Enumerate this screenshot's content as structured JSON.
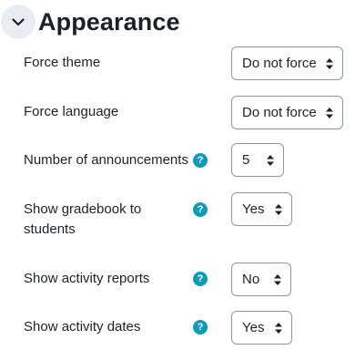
{
  "section": {
    "title": "Appearance",
    "toggle_icon": "chevron-down-icon"
  },
  "fields": [
    {
      "label": "Force theme",
      "value": "Do not force",
      "has_help": false
    },
    {
      "label": "Force language",
      "value": "Do not force",
      "has_help": false
    },
    {
      "label": "Number of announcements",
      "value": "5",
      "has_help": true
    },
    {
      "label_line1": "Show gradebook to",
      "label_line2": "students",
      "value": "Yes",
      "has_help": true
    },
    {
      "label": "Show activity reports",
      "value": "No",
      "has_help": true
    },
    {
      "label": "Show activity dates",
      "value": "Yes",
      "has_help": true
    }
  ],
  "help_icon": {
    "glyph": "?",
    "color": "#0f9bb4"
  },
  "colors": {
    "text": "#1d2125",
    "toggle_bg": "#e9edf2",
    "select_border": "#8f959e"
  }
}
